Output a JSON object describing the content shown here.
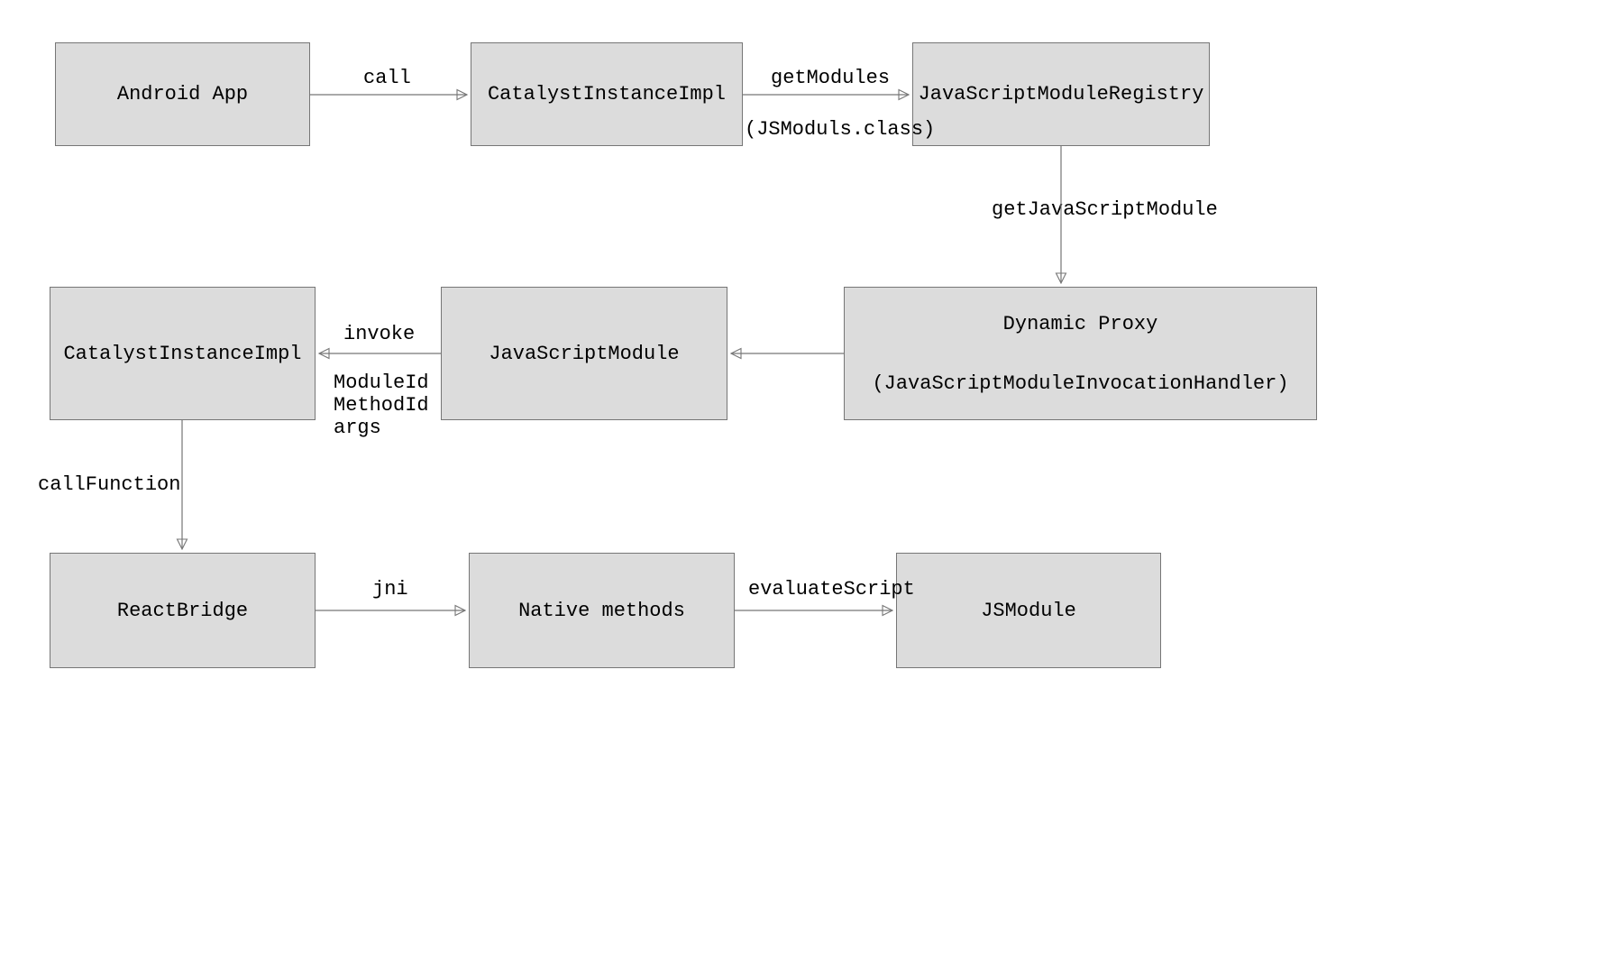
{
  "nodes": {
    "android_app": {
      "label": "Android App"
    },
    "catalyst1": {
      "label": "CatalystInstanceImpl"
    },
    "js_registry": {
      "label": "JavaScriptModuleRegistry"
    },
    "dynamic_proxy": {
      "label": "Dynamic Proxy\n\n(JavaScriptModuleInvocationHandler)"
    },
    "js_module": {
      "label": "JavaScriptModule"
    },
    "catalyst2": {
      "label": "CatalystInstanceImpl"
    },
    "react_bridge": {
      "label": "ReactBridge"
    },
    "native_methods": {
      "label": "Native methods"
    },
    "js_module2": {
      "label": "JSModule"
    }
  },
  "edges": {
    "call": {
      "label": "call"
    },
    "get_modules_top": {
      "label": "getModules"
    },
    "get_modules_bot": {
      "label": "(JSModuls.class)"
    },
    "get_js_module": {
      "label": "getJavaScriptModule"
    },
    "invoke": {
      "label": "invoke"
    },
    "invoke_sub": {
      "label": "ModuleId\nMethodId\nargs"
    },
    "call_function": {
      "label": "callFunction"
    },
    "jni": {
      "label": "jni"
    },
    "evaluate_script": {
      "label": "evaluateScript"
    }
  }
}
